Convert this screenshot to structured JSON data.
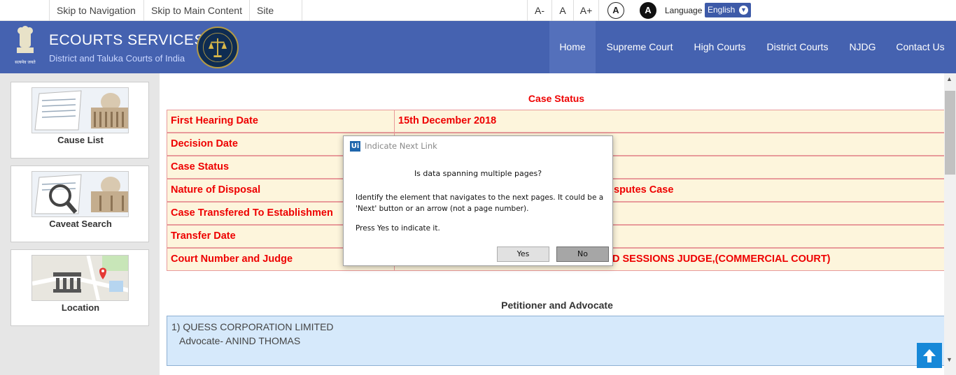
{
  "topbar": {
    "skip_nav": "Skip to Navigation",
    "skip_main": "Skip to Main Content",
    "site_map": "Site map",
    "font_decrease": "A-",
    "font_normal": "A",
    "font_increase": "A+",
    "contrast_normal": "A",
    "contrast_high": "A",
    "language_label": "Language",
    "language_value": "English"
  },
  "header": {
    "title": "ECOURTS SERVICES",
    "subtitle": "District and Taluka Courts of India",
    "emblem_caption": "सत्यमेव जयते",
    "nav": [
      "Home",
      "Supreme Court",
      "High Courts",
      "District Courts",
      "NJDG",
      "Contact Us"
    ],
    "active_nav": "Home",
    "brand_color": "#4562b0"
  },
  "sidebar": {
    "cards": [
      {
        "label": "Cause List",
        "icon": "court-building-icon"
      },
      {
        "label": "Caveat Search",
        "icon": "magnifier-icon"
      },
      {
        "label": "Location",
        "icon": "map-pin-icon"
      }
    ]
  },
  "case_status": {
    "title": "Case Status",
    "rows": [
      {
        "label": "First Hearing Date",
        "value": "15th December 2018"
      },
      {
        "label": "Decision Date",
        "value": ""
      },
      {
        "label": "Case Status",
        "value": ""
      },
      {
        "label": "Nature of Disposal",
        "value": "sputes Case"
      },
      {
        "label": "Case Transfered To Establishmen",
        "value": ""
      },
      {
        "label": "Transfer Date",
        "value": ""
      },
      {
        "label": "Court Number and Judge",
        "value": "D SESSIONS JUDGE,(COMMERCIAL COURT)"
      }
    ],
    "accent_color": "#ee0000"
  },
  "petitioner": {
    "title": "Petitioner and Advocate",
    "party": "1) QUESS CORPORATION LIMITED",
    "advocate": "Advocate- ANIND THOMAS"
  },
  "dialog": {
    "logo": "Ui",
    "title": "Indicate Next Link",
    "heading": "Is data spanning multiple pages?",
    "body": "Identify the element that navigates to the next pages. It could be a 'Next' button or an arrow (not a page number).",
    "press_note": "Press Yes to indicate it.",
    "yes_label": "Yes",
    "no_label": "No"
  }
}
